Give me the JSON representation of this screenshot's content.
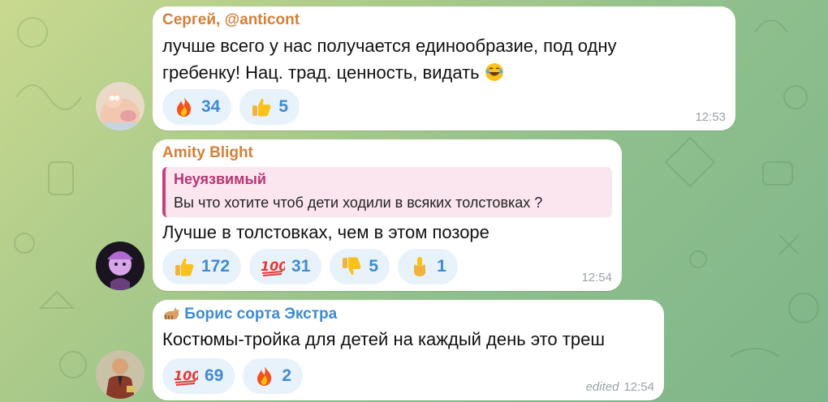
{
  "messages": [
    {
      "author": "Сергей, @anticont",
      "author_color": "#d3803a",
      "lines": [
        "лучше всего у нас получается единообразие, под одну",
        "гребенку! Нац. трад. ценность, видать"
      ],
      "reactions": [
        {
          "emoji": "fire-emoji",
          "count": "34"
        },
        {
          "emoji": "thumbs-up-emoji",
          "count": "5"
        }
      ],
      "time": "12:53"
    },
    {
      "author": "Amity Blight",
      "author_color": "#d3803a",
      "reply": {
        "name": "Неуязвимый",
        "text": "Вы что хотите чтоб дети ходили в всяких толстовках ?"
      },
      "lines": [
        "Лучше в толстовках, чем в этом позоре"
      ],
      "reactions": [
        {
          "emoji": "thumbs-up-emoji",
          "count": "172"
        },
        {
          "emoji": "hundred-points-emoji",
          "count": "31"
        },
        {
          "emoji": "thumbs-down-emoji",
          "count": "5"
        },
        {
          "emoji": "middle-finger-emoji",
          "count": "1"
        }
      ],
      "time": "12:54"
    },
    {
      "author": "Борис сорта Экстра",
      "author_color": "#3f8bd0",
      "lines": [
        "Костюмы-тройка для детей на каждый день это треш"
      ],
      "reactions": [
        {
          "emoji": "hundred-points-emoji",
          "count": "69"
        },
        {
          "emoji": "fire-emoji",
          "count": "2"
        }
      ],
      "edited": "edited",
      "time": "12:54"
    }
  ],
  "colors": {
    "reaction_count": "#3f8bd0",
    "reply_accent": "#c5407e",
    "time": "#9aa3a8"
  }
}
